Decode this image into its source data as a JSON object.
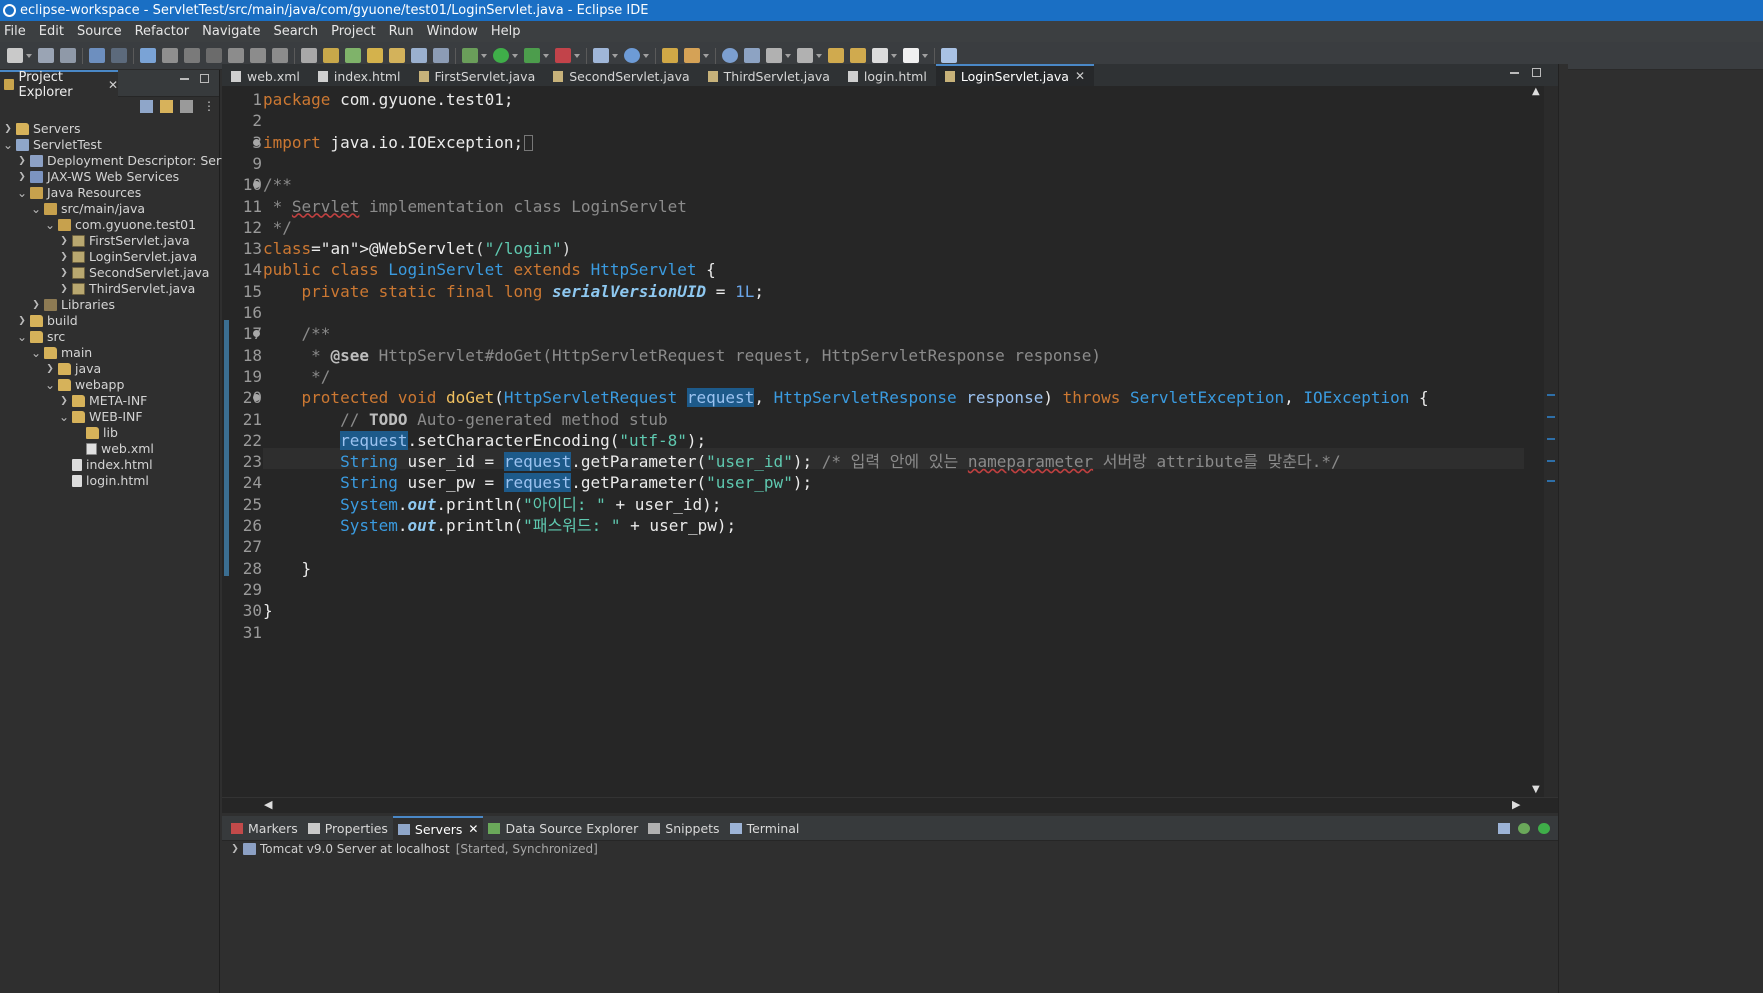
{
  "window": {
    "title": "eclipse-workspace - ServletTest/src/main/java/com/gyuone/test01/LoginServlet.java - Eclipse IDE"
  },
  "menu": [
    "File",
    "Edit",
    "Source",
    "Refactor",
    "Navigate",
    "Search",
    "Project",
    "Run",
    "Window",
    "Help"
  ],
  "project_explorer": {
    "tab_label": "Project Explorer",
    "tree": [
      {
        "label": "Servers",
        "level": 0,
        "expanded": false,
        "icon": "folder-icon"
      },
      {
        "label": "ServletTest",
        "level": 0,
        "expanded": true,
        "icon": "project-icon"
      },
      {
        "label": "Deployment Descriptor: ServletTest",
        "level": 1,
        "expanded": false,
        "icon": "deployment-descriptor-icon"
      },
      {
        "label": "JAX-WS Web Services",
        "level": 1,
        "expanded": false,
        "icon": "web-services-icon"
      },
      {
        "label": "Java Resources",
        "level": 1,
        "expanded": true,
        "icon": "java-resources-icon"
      },
      {
        "label": "src/main/java",
        "level": 2,
        "expanded": true,
        "icon": "source-folder-icon"
      },
      {
        "label": "com.gyuone.test01",
        "level": 3,
        "expanded": true,
        "icon": "package-icon"
      },
      {
        "label": "FirstServlet.java",
        "level": 4,
        "expanded": false,
        "icon": "java-file-icon"
      },
      {
        "label": "LoginServlet.java",
        "level": 4,
        "expanded": false,
        "icon": "java-file-icon"
      },
      {
        "label": "SecondServlet.java",
        "level": 4,
        "expanded": false,
        "icon": "java-file-icon"
      },
      {
        "label": "ThirdServlet.java",
        "level": 4,
        "expanded": false,
        "icon": "java-file-icon"
      },
      {
        "label": "Libraries",
        "level": 2,
        "expanded": false,
        "icon": "library-icon"
      },
      {
        "label": "build",
        "level": 1,
        "expanded": false,
        "icon": "folder-icon"
      },
      {
        "label": "src",
        "level": 1,
        "expanded": true,
        "icon": "folder-icon"
      },
      {
        "label": "main",
        "level": 2,
        "expanded": true,
        "icon": "folder-icon"
      },
      {
        "label": "java",
        "level": 3,
        "expanded": false,
        "icon": "folder-icon"
      },
      {
        "label": "webapp",
        "level": 3,
        "expanded": true,
        "icon": "folder-icon"
      },
      {
        "label": "META-INF",
        "level": 4,
        "expanded": false,
        "icon": "folder-icon"
      },
      {
        "label": "WEB-INF",
        "level": 4,
        "expanded": true,
        "icon": "folder-icon"
      },
      {
        "label": "lib",
        "level": 5,
        "expanded": null,
        "icon": "folder-icon"
      },
      {
        "label": "web.xml",
        "level": 5,
        "expanded": null,
        "icon": "xml-file-icon"
      },
      {
        "label": "index.html",
        "level": 4,
        "expanded": null,
        "icon": "html-file-icon"
      },
      {
        "label": "login.html",
        "level": 4,
        "expanded": null,
        "icon": "html-file-icon"
      }
    ]
  },
  "editor_tabs": [
    {
      "label": "web.xml",
      "active": false
    },
    {
      "label": "index.html",
      "active": false
    },
    {
      "label": "FirstServlet.java",
      "active": false
    },
    {
      "label": "SecondServlet.java",
      "active": false
    },
    {
      "label": "ThirdServlet.java",
      "active": false
    },
    {
      "label": "login.html",
      "active": false
    },
    {
      "label": "LoginServlet.java",
      "active": true
    }
  ],
  "code_lines": [
    {
      "n": "1",
      "text": "package com.gyuone.test01;"
    },
    {
      "n": "2",
      "text": ""
    },
    {
      "n": "3",
      "text": "import java.io.IOException;"
    },
    {
      "n": "9",
      "text": ""
    },
    {
      "n": "10",
      "text": "/**"
    },
    {
      "n": "11",
      "text": " * Servlet implementation class LoginServlet"
    },
    {
      "n": "12",
      "text": " */"
    },
    {
      "n": "13",
      "text": "@WebServlet(\"/login\")"
    },
    {
      "n": "14",
      "text": "public class LoginServlet extends HttpServlet {"
    },
    {
      "n": "15",
      "text": "    private static final long serialVersionUID = 1L;"
    },
    {
      "n": "16",
      "text": ""
    },
    {
      "n": "17",
      "text": "    /**"
    },
    {
      "n": "18",
      "text": "     * @see HttpServlet#doGet(HttpServletRequest request, HttpServletResponse response)"
    },
    {
      "n": "19",
      "text": "     */"
    },
    {
      "n": "20",
      "text": "    protected void doGet(HttpServletRequest request, HttpServletResponse response) throws ServletException, IOException {"
    },
    {
      "n": "21",
      "text": "        // TODO Auto-generated method stub"
    },
    {
      "n": "22",
      "text": "        request.setCharacterEncoding(\"utf-8\");"
    },
    {
      "n": "23",
      "text": "        String user_id = request.getParameter(\"user_id\"); /* 입력 안에 있는 nameparameter 서버랑 attribute를 맞춘다.*/"
    },
    {
      "n": "24",
      "text": "        String user_pw = request.getParameter(\"user_pw\");"
    },
    {
      "n": "25",
      "text": "        System.out.println(\"아이디: \" + user_id);"
    },
    {
      "n": "26",
      "text": "        System.out.println(\"패스워드: \" + user_pw);"
    },
    {
      "n": "27",
      "text": ""
    },
    {
      "n": "28",
      "text": "    }"
    },
    {
      "n": "29",
      "text": ""
    },
    {
      "n": "30",
      "text": "}"
    },
    {
      "n": "31",
      "text": ""
    }
  ],
  "bottom_tabs": [
    {
      "label": "Markers",
      "active": false,
      "icon": "markers-icon"
    },
    {
      "label": "Properties",
      "active": false,
      "icon": "properties-icon"
    },
    {
      "label": "Servers",
      "active": true,
      "icon": "servers-icon"
    },
    {
      "label": "Data Source Explorer",
      "active": false,
      "icon": "data-source-icon"
    },
    {
      "label": "Snippets",
      "active": false,
      "icon": "snippets-icon"
    },
    {
      "label": "Terminal",
      "active": false,
      "icon": "terminal-icon"
    }
  ],
  "servers": [
    {
      "name": "Tomcat v9.0 Server at localhost",
      "status": "[Started, Synchronized]"
    }
  ],
  "colors": {
    "title_bar": "#1a6fc4",
    "active_tab_accent": "#4a88c7",
    "editor_bg": "#262626"
  }
}
